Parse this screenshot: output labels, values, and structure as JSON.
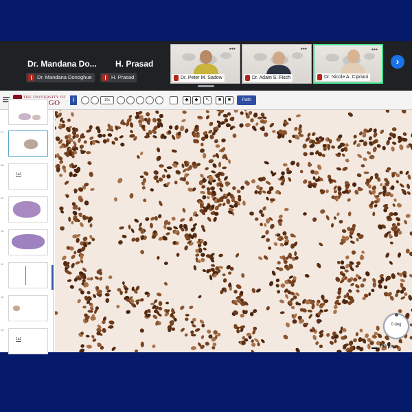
{
  "meeting": {
    "participants_top": [
      "Dr. Mandana Do...",
      "H. Prasad"
    ],
    "participant_chips": [
      "Dr. Mandana Donoghue",
      "H. Prasad"
    ],
    "video_tiles": [
      "Dr. Peter M. Sadow",
      "Dr. Adam S. Fisch",
      "Dr. Nicole A. Cipriani"
    ],
    "active_speaker_color": "#3ee08f",
    "next_icon": "chevron-right-icon"
  },
  "viewer": {
    "brand_small": "THE UNIVERSITY OF",
    "brand_big": "CHICAGO",
    "info_label": "i",
    "zoom_label": "10x",
    "path_button": "Path",
    "slide_numbers": [
      "",
      "07",
      "08",
      "09",
      "10",
      "11",
      "12",
      "13"
    ],
    "slide_label_text": "1a1",
    "orientation": "0 deg",
    "scale": "100 µm",
    "stain_color": "#6b3a1a"
  }
}
